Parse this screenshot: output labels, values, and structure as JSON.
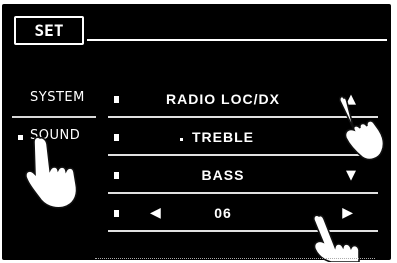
{
  "header": {
    "title": "SET"
  },
  "sidebar": {
    "items": [
      {
        "label": "SYSTEM"
      },
      {
        "label": "SOUND"
      }
    ]
  },
  "menu": {
    "rows": [
      {
        "label": "RADIO LOC/DX"
      },
      {
        "label": "TREBLE"
      },
      {
        "label": "BASS"
      },
      {
        "label": "06"
      }
    ]
  },
  "icons": {
    "up_arrow": "up-arrow-icon",
    "down_arrow": "down-arrow-icon",
    "left_arrow": "left-arrow-icon",
    "right_arrow": "right-arrow-icon",
    "hand": "pointing-hand-icon"
  }
}
